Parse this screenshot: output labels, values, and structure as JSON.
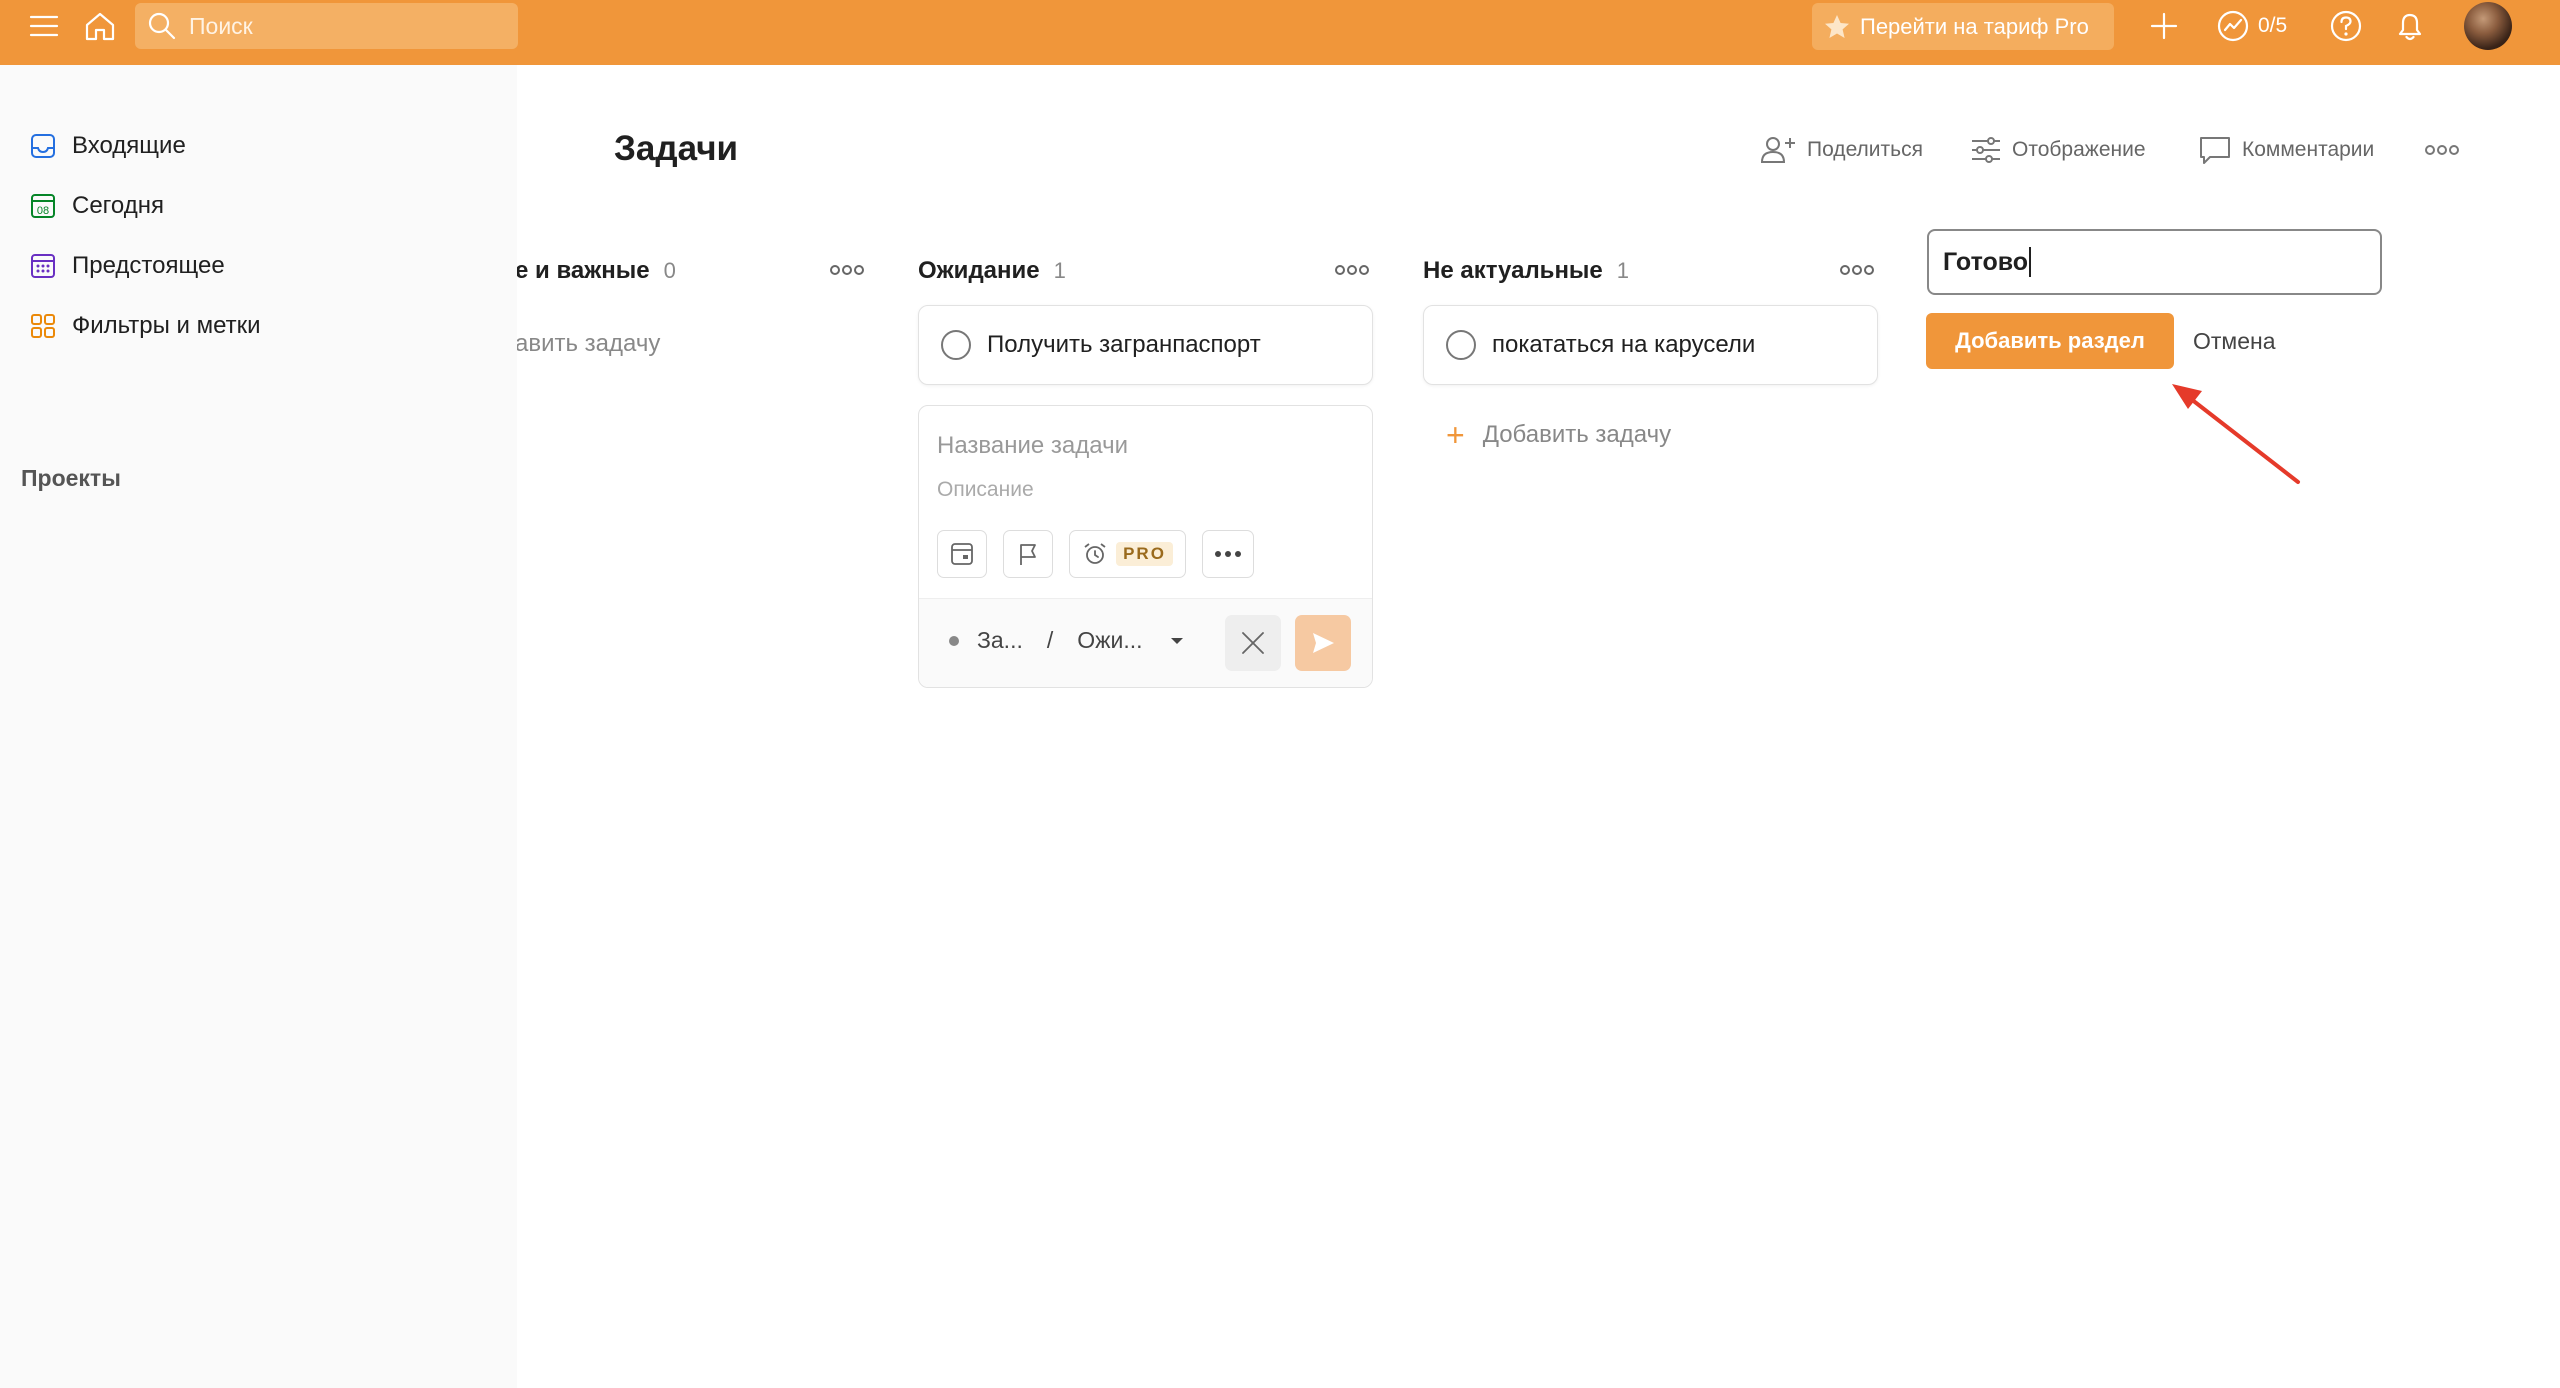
{
  "topbar": {
    "search_placeholder": "Поиск",
    "pro_button": "Перейти на тариф Pro",
    "karma": "0/5",
    "accent": "#f0963a"
  },
  "sidebar": {
    "items": [
      {
        "label": "Входящие",
        "icon": "inbox-icon"
      },
      {
        "label": "Сегодня",
        "icon": "calendar-today-icon",
        "icon_text": "08"
      },
      {
        "label": "Предстоящее",
        "icon": "calendar-upcoming-icon"
      },
      {
        "label": "Фильтры и метки",
        "icon": "filters-grid-icon"
      }
    ],
    "projects_label": "Проекты"
  },
  "main": {
    "title": "Задачи",
    "actions": {
      "share": "Поделиться",
      "view": "Отображение",
      "comments": "Комментарии"
    },
    "columns": [
      {
        "name": "е и важные",
        "count": "0",
        "add_task": "авить задачу"
      },
      {
        "name": "Ожидание",
        "count": "1",
        "task": "Получить загранпаспорт"
      },
      {
        "name": "Не актуальные",
        "count": "1",
        "task": "покататься на карусели",
        "add_task": "Добавить задачу"
      }
    ],
    "editor": {
      "name_placeholder": "Название задачи",
      "desc_placeholder": "Описание",
      "pro_tag": "PRO",
      "project": "За...",
      "separator": "/",
      "section": "Ожи..."
    },
    "new_section": {
      "value": "Готово",
      "add_button": "Добавить раздел",
      "cancel": "Отмена"
    }
  }
}
